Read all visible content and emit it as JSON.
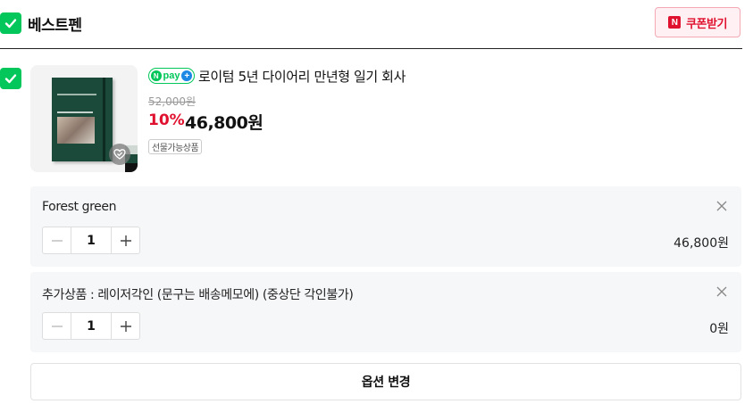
{
  "store": {
    "name": "베스트펜"
  },
  "coupon": {
    "label": "쿠폰받기",
    "logo_letter": "N"
  },
  "product": {
    "npay_label": "pay",
    "npay_n": "N",
    "npay_plus": "+",
    "title": "로이텀 5년 다이어리 만년형 일기 회사",
    "original_price": "52,000원",
    "discount": "10%",
    "price": "46,800원",
    "tag": "선물가능상품"
  },
  "options": [
    {
      "name": "Forest green",
      "quantity": "1",
      "price": "46,800원"
    },
    {
      "name": "추가상품 : 레이저각인 (문구는 배송메모에) (중상단 각인불가)",
      "quantity": "1",
      "price": "0원"
    }
  ],
  "change_option": {
    "label": "옵션 변경"
  },
  "colors": {
    "green": "#03c75a",
    "red": "#e0112f",
    "option_bg": "#f6f7f9"
  },
  "icons": [
    "check-icon",
    "close-icon",
    "minus-icon",
    "plus-icon",
    "heart-check-icon"
  ]
}
